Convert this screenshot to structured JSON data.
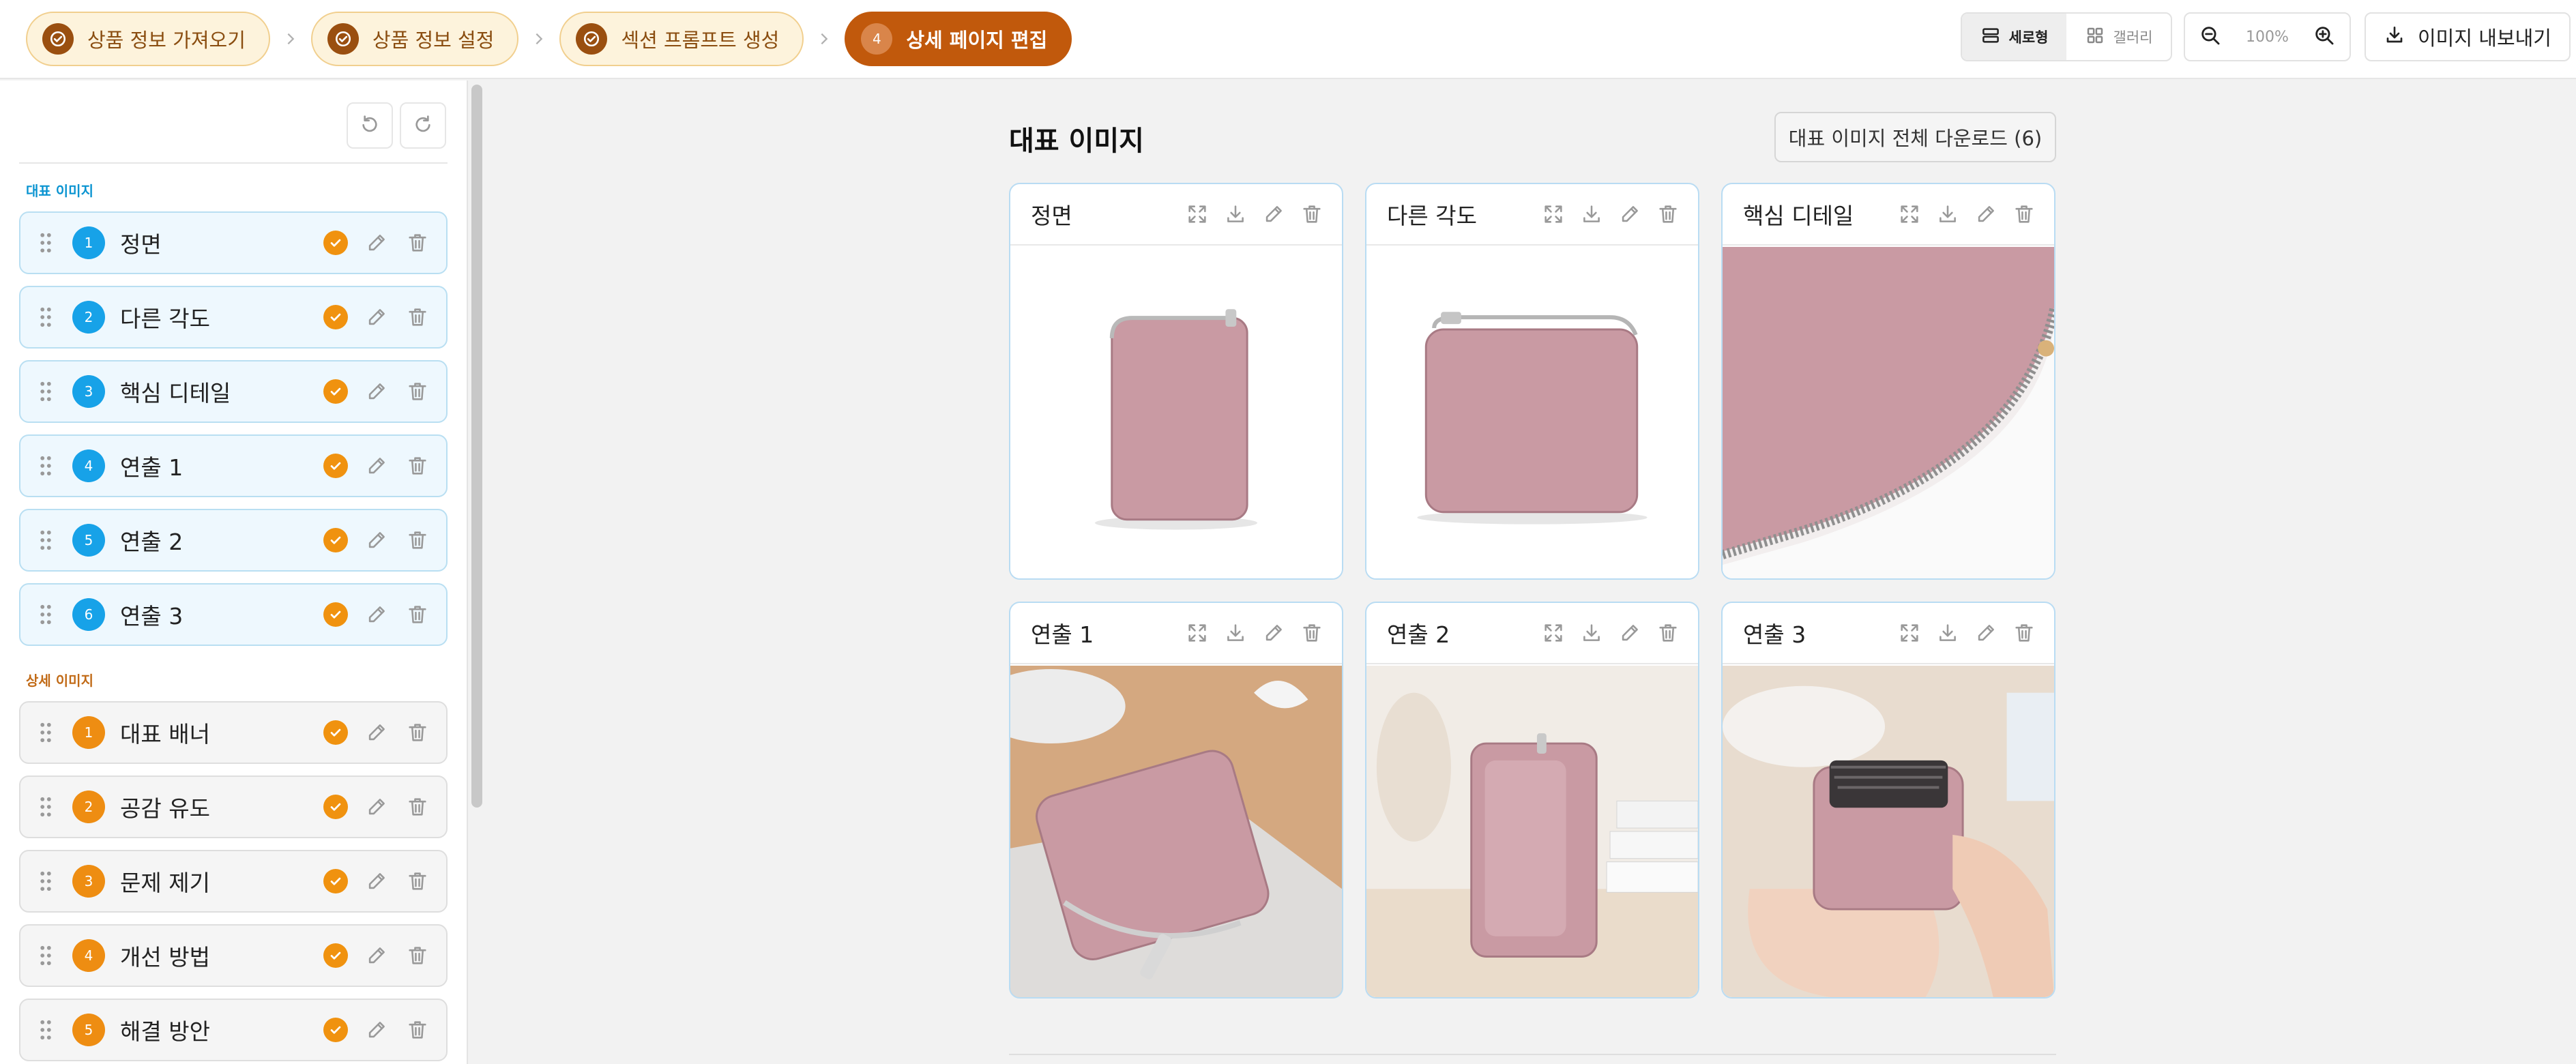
{
  "steps": [
    {
      "label": "상품 정보 가져오기",
      "status": "done"
    },
    {
      "label": "상품 정보 설정",
      "status": "done"
    },
    {
      "label": "섹션 프롬프트 생성",
      "status": "done"
    },
    {
      "label": "상세 페이지 편집",
      "status": "active",
      "number": "4"
    }
  ],
  "toolbar": {
    "view_vertical": "세로형",
    "view_gallery": "갤러리",
    "zoom_level": "100%",
    "export_label": "이미지 내보내기"
  },
  "sidebar": {
    "rep_section_label": "대표 이미지",
    "rep_items": [
      {
        "num": "1",
        "label": "정면"
      },
      {
        "num": "2",
        "label": "다른 각도"
      },
      {
        "num": "3",
        "label": "핵심 디테일"
      },
      {
        "num": "4",
        "label": "연출 1"
      },
      {
        "num": "5",
        "label": "연출 2"
      },
      {
        "num": "6",
        "label": "연출 3"
      }
    ],
    "detail_section_label": "상세 이미지",
    "detail_items": [
      {
        "num": "1",
        "label": "대표 배너"
      },
      {
        "num": "2",
        "label": "공감 유도"
      },
      {
        "num": "3",
        "label": "문제 제기"
      },
      {
        "num": "4",
        "label": "개선 방법"
      },
      {
        "num": "5",
        "label": "해결 방안"
      }
    ]
  },
  "main": {
    "title": "대표 이미지",
    "download_all_label": "대표 이미지 전체 다운로드 (6)",
    "cards": [
      {
        "title": "정면"
      },
      {
        "title": "다른 각도"
      },
      {
        "title": "핵심 디테일"
      },
      {
        "title": "연출 1"
      },
      {
        "title": "연출 2"
      },
      {
        "title": "연출 3"
      }
    ]
  },
  "colors": {
    "accent_orange": "#c1590c",
    "step_done_bg": "#fdf3dc",
    "rep_badge_blue": "#17a2e8",
    "detail_badge_orange": "#ee8d12",
    "check_orange": "#f0920f",
    "product_pink": "#c99aa3"
  },
  "icons": {
    "step_done": "check-circle-icon",
    "chevron": "chevron-right-icon",
    "view_vertical": "rows-icon",
    "view_gallery": "grid-icon",
    "zoom_out": "zoom-out-icon",
    "zoom_in": "zoom-in-icon",
    "export": "download-icon",
    "undo": "undo-icon",
    "redo": "redo-icon",
    "drag": "drag-handle-icon",
    "status": "check-icon",
    "edit": "pencil-icon",
    "delete": "trash-icon",
    "expand": "expand-icon"
  }
}
